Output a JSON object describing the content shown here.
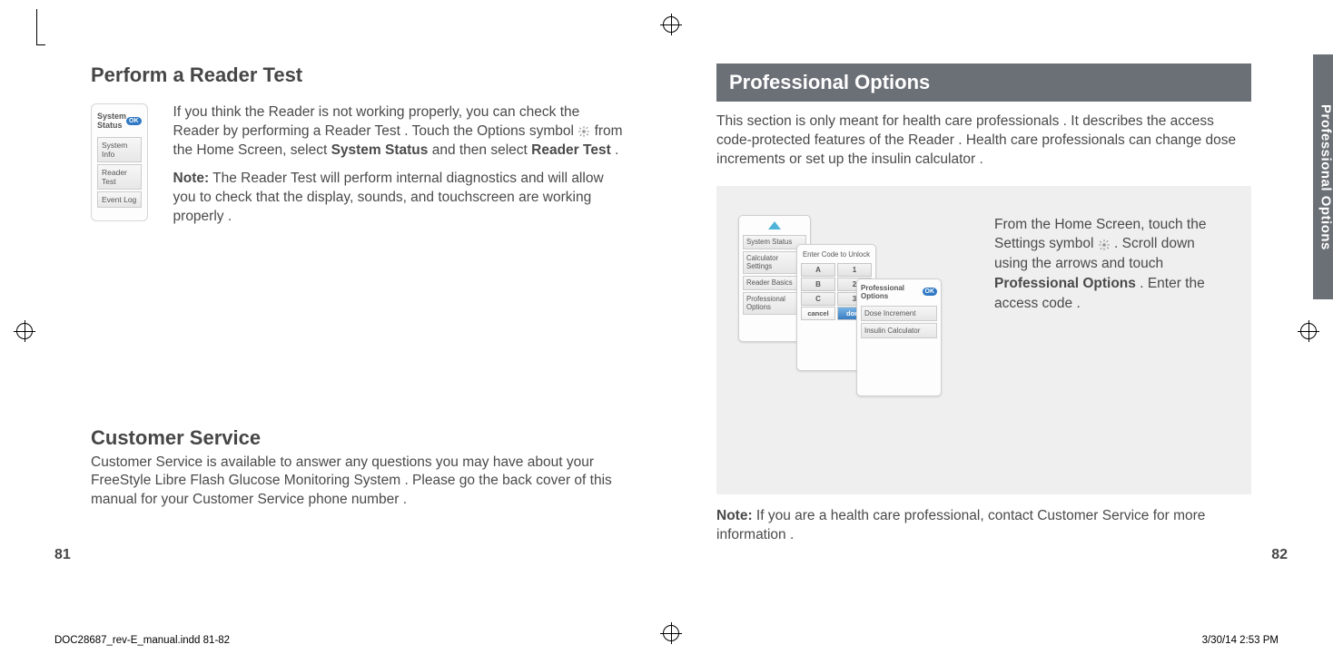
{
  "left": {
    "heading": "Perform a Reader Test",
    "device": {
      "title": "System Status",
      "ok": "OK",
      "rows": [
        "System  Info",
        "Reader  Test",
        "Event Log"
      ]
    },
    "para1a": "If you think the Reader is not working properly, you can check the Reader by performing a Reader Test . Touch the Options symbol ",
    "para1b": " from the Home Screen, select ",
    "para1_bold1": "System Status",
    "para1c": " and then select ",
    "para1_bold2": "Reader Test",
    "para1d": " .",
    "para2a": "Note:",
    "para2b": " The Reader Test will perform internal diagnostics and will allow you to check that the display, sounds, and touchscreen are working properly .",
    "cs_heading": "Customer Service",
    "cs_body": "Customer Service is available to answer any questions you may have about your FreeStyle Libre Flash Glucose Monitoring System . Please go the back cover of this manual for your Customer Service phone number .",
    "page_num": "81"
  },
  "right": {
    "bar_title": "Professional Options",
    "intro": "This section is only meant for health care professionals . It describes the access code-protected features of the Reader . Health care professionals can change dose increments or set up the insulin calculator .",
    "m1_rows": [
      "System Status",
      "Calculator Settings",
      "Reader Basics",
      "Professional Options"
    ],
    "m2_title": "Enter Code to Unlock",
    "m2_kA": "A",
    "m2_k1": "1",
    "m2_kB": "B",
    "m2_k2": "2",
    "m2_kC": "C",
    "m2_k3": "3",
    "m2_cancel": "cancel",
    "m2_done": "done",
    "m3_title": "Professional Options",
    "m3_ok": "OK",
    "m3_row1": "Dose Increment",
    "m3_row2": "Insulin  Calculator",
    "rtext_a": "From the Home Screen, touch the Settings symbol ",
    "rtext_b": " . Scroll down using the arrows and touch ",
    "rtext_bold": "Professional Options",
    "rtext_c": " . Enter the access code .",
    "note_a": "Note:",
    "note_b": " If you are a health care professional, contact Customer Service for more information .",
    "page_num": "82",
    "side_tab": "Professional Options"
  },
  "footer": {
    "left": "DOC28687_rev-E_manual.indd   81-82",
    "right": "3/30/14   2:53 PM"
  }
}
